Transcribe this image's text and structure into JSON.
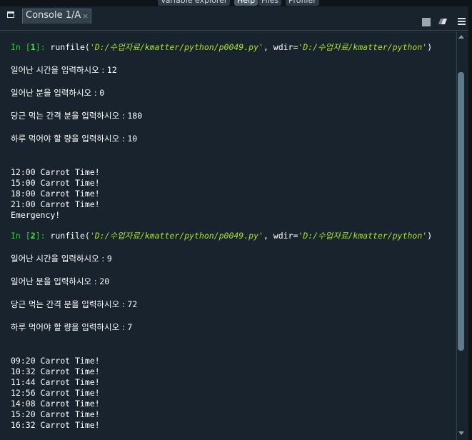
{
  "top_tabs": [
    "Variable explorer",
    "Help",
    "Files",
    "Profiler"
  ],
  "console_tab": {
    "label": "Console 1/A",
    "close": "×"
  },
  "prompts": [
    {
      "label": "In [",
      "num": "1",
      "end": "]: ",
      "call": "runfile(",
      "path": "'D:/수업자료/kmatter/python/p0049.py'",
      "sep": ", wdir=",
      "wdir": "'D:/수업자료/kmatter/python'",
      "close": ")"
    },
    {
      "label": "In [",
      "num": "2",
      "end": "]: ",
      "call": "runfile(",
      "path": "'D:/수업자료/kmatter/python/p0049.py'",
      "sep": ", wdir=",
      "wdir": "'D:/수업자료/kmatter/python'",
      "close": ")"
    }
  ],
  "run1": {
    "inputs": [
      {
        "prompt": "일어난 시간을 입력하시오 : ",
        "value": "12"
      },
      {
        "prompt": "일어난 분을 입력하시오 : ",
        "value": "0"
      },
      {
        "prompt": "당근 먹는 간격 분을 입력하시오 : ",
        "value": "180"
      },
      {
        "prompt": "하루 먹어야 할 량을 입력하시오 : ",
        "value": "10"
      }
    ],
    "outputs": [
      "12:00 Carrot Time!",
      "15:00 Carrot Time!",
      "18:00 Carrot Time!",
      "21:00 Carrot Time!",
      "Emergency!"
    ]
  },
  "run2": {
    "inputs": [
      {
        "prompt": "일어난 시간을 입력하시오 : ",
        "value": "9"
      },
      {
        "prompt": "일어난 분을 입력하시오 : ",
        "value": "20"
      },
      {
        "prompt": "당근 먹는 간격 분을 입력하시오 : ",
        "value": "72"
      },
      {
        "prompt": "하루 먹어야 할 량을 입력하시오 : ",
        "value": "7"
      }
    ],
    "outputs": [
      "09:20 Carrot Time!",
      "10:32 Carrot Time!",
      "11:44 Carrot Time!",
      "12:56 Carrot Time!",
      "14:08 Carrot Time!",
      "15:20 Carrot Time!",
      "16:32 Carrot Time!"
    ]
  },
  "icons": {
    "pane": "window-icon",
    "stop": "stop-icon",
    "clear": "eraser-icon",
    "menu": "hamburger-menu-icon"
  },
  "colors": {
    "background": "#19232d",
    "prompt": "#1ed61e",
    "string": "#a6e22e",
    "text": "#ffffff"
  }
}
